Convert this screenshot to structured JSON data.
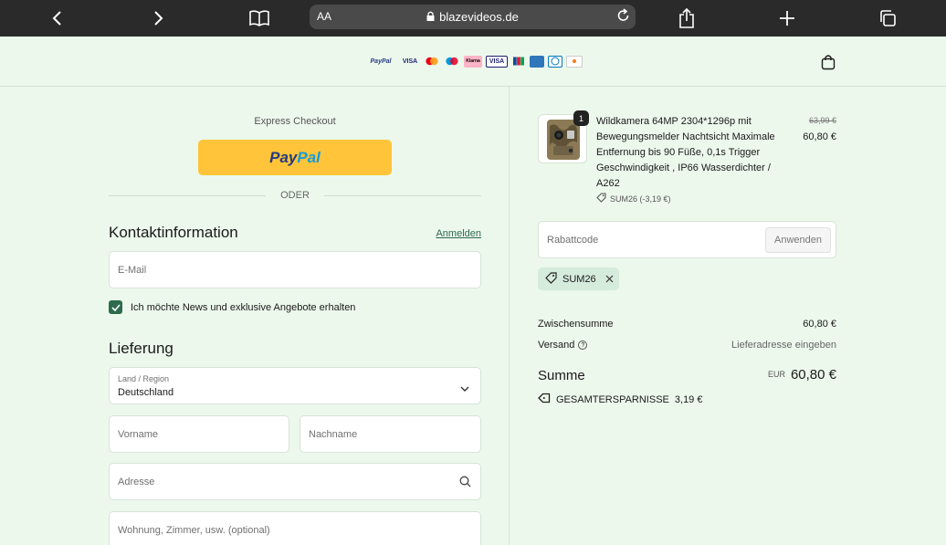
{
  "browser": {
    "text_size_label": "AA",
    "url": "blazevideos.de"
  },
  "header": {
    "payment_logos": [
      "PayPal",
      "VISA",
      "Mastercard",
      "Maestro",
      "Klarna",
      "VISA",
      "JCB",
      "American Express",
      "Diners Club",
      "Discover"
    ],
    "cart_icon": "shopping-bag-icon"
  },
  "checkout": {
    "express_label": "Express Checkout",
    "paypal_label_1": "Pay",
    "paypal_label_2": "Pal",
    "separator": "ODER",
    "contact": {
      "title": "Kontaktinformation",
      "login_link": "Anmelden",
      "email_placeholder": "E-Mail",
      "newsletter_label": "Ich möchte News und exklusive Angebote erhalten",
      "newsletter_checked": true
    },
    "delivery": {
      "title": "Lieferung",
      "country_label": "Land / Region",
      "country_value": "Deutschland",
      "firstname_placeholder": "Vorname",
      "lastname_placeholder": "Nachname",
      "address_placeholder": "Adresse",
      "apartment_placeholder": "Wohnung, Zimmer, usw. (optional)"
    }
  },
  "summary": {
    "product": {
      "quantity": "1",
      "name": "Wildkamera 64MP 2304*1296p mit Bewegungsmelder Nachtsicht Maximale Entfernung bis 90 Füße, 0,1s Trigger Geschwindigkeit , IP66 Wasserdichter / A262",
      "discount_note": "SUM26 (-3,19 €)",
      "old_price": "63,99 €",
      "price": "60,80 €"
    },
    "discount_placeholder": "Rabattcode",
    "apply_label": "Anwenden",
    "applied_code": "SUM26",
    "subtotal_label": "Zwischensumme",
    "subtotal_value": "60,80 €",
    "shipping_label": "Versand",
    "shipping_value": "Lieferadresse eingeben",
    "total_label": "Summe",
    "total_currency": "EUR",
    "total_value": "60,80 €",
    "savings_label": "GESAMTERSPARNISSE",
    "savings_value": "3,19 €"
  },
  "colors": {
    "page_bg": "#ecf8ec",
    "accent": "#2e6b4a",
    "paypal_yellow": "#ffc439",
    "browser_bar": "#2a2a2a"
  }
}
